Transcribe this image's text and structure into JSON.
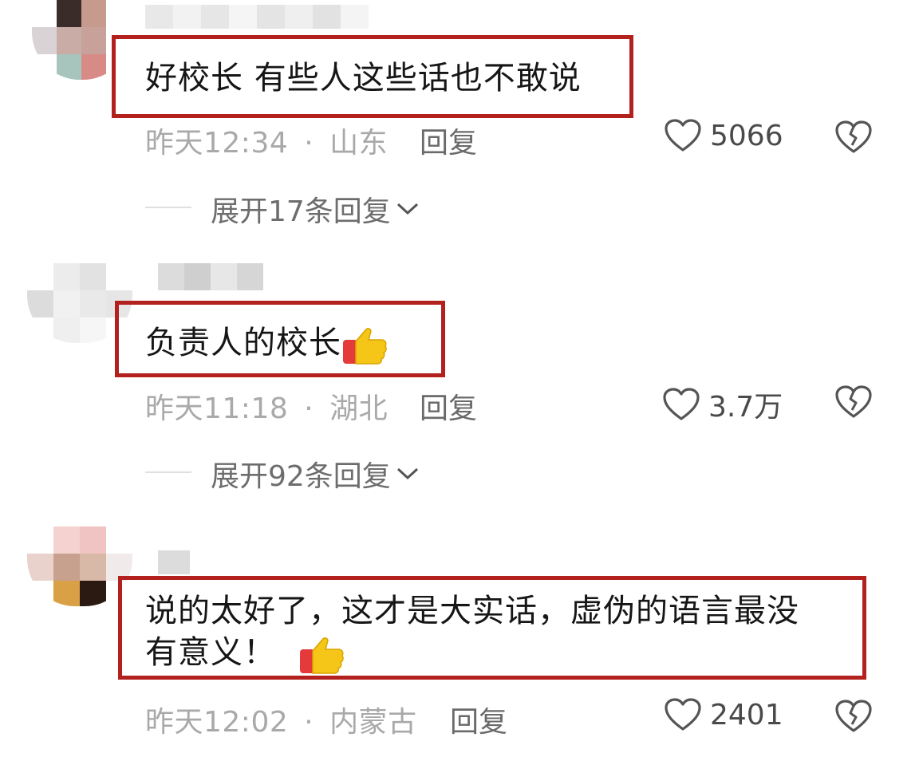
{
  "comments": [
    {
      "text": "好校长 有些人这些话也不敢说",
      "time": "昨天12:34",
      "location": "山东",
      "reply_label": "回复",
      "likes": "5066",
      "expand_label": "展开17条回复"
    },
    {
      "text": "负责人的校长",
      "time": "昨天11:18",
      "location": "湖北",
      "reply_label": "回复",
      "likes": "3.7万",
      "expand_label": "展开92条回复"
    },
    {
      "text_line1": "说的太好了，这才是大实话，虚伪的语言最没",
      "text_line2": "有意义！",
      "time": "昨天12:02",
      "location": "内蒙古",
      "reply_label": "回复",
      "likes": "2401"
    }
  ],
  "separator": "·",
  "icons": {
    "like": "heart-outline-icon",
    "dislike": "broken-heart-icon",
    "expand": "chevron-down-icon",
    "emoji": "thumbs-up-emoji"
  },
  "colors": {
    "highlight_box": "#b3211f",
    "meta_text": "#a9a9a9",
    "body_text": "#161616"
  }
}
